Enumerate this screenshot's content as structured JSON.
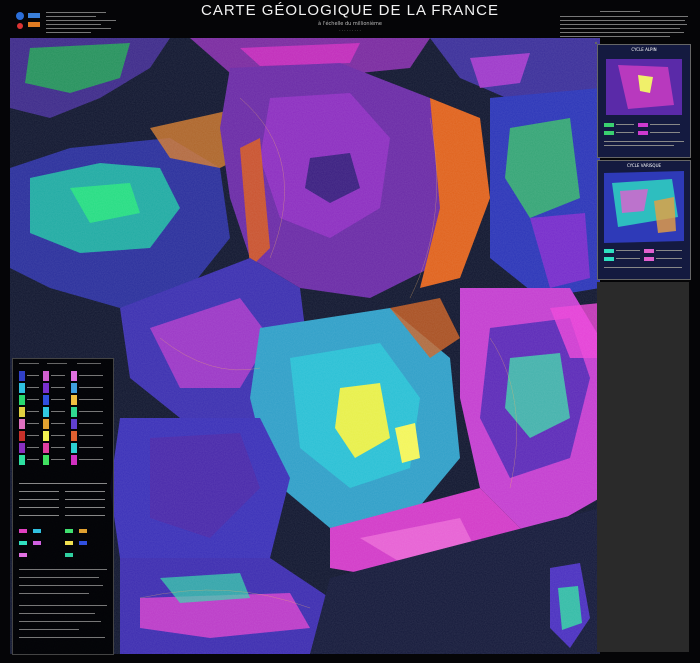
{
  "header": {
    "title": "CARTE GÉOLOGIQUE DE LA FRANCE",
    "subtitle": "à l'échelle du millionième"
  },
  "insets": [
    {
      "label": "CYCLE ALPIN"
    },
    {
      "label": "CYCLE VARISQUE"
    }
  ],
  "colors": {
    "background": "#000000",
    "sea": "#11162e",
    "title": "#f2f2f2"
  }
}
